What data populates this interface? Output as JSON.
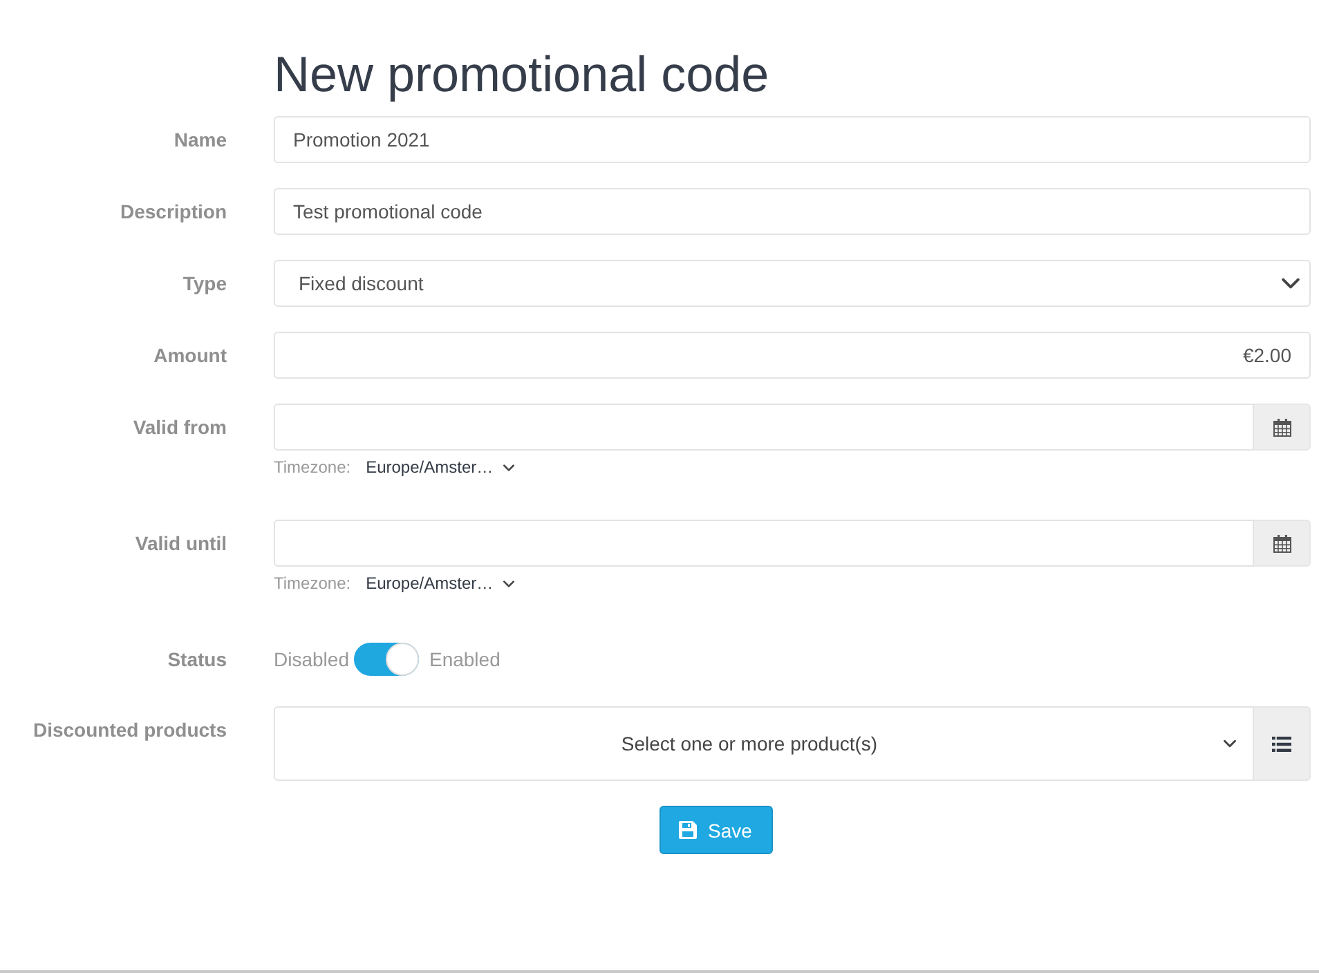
{
  "title": "New promotional code",
  "fields": [
    {
      "kind": "text",
      "label": "Name",
      "value": "Promotion 2021"
    },
    {
      "kind": "text",
      "label": "Description",
      "value": "Test promotional code"
    },
    {
      "kind": "select",
      "label": "Type",
      "value": "Fixed discount"
    },
    {
      "kind": "amount",
      "label": "Amount",
      "value": "€2.00"
    },
    {
      "kind": "date",
      "label": "Valid from",
      "timezone_label": "Timezone:",
      "timezone": "Europe/Amster…"
    },
    {
      "kind": "date",
      "label": "Valid until",
      "timezone_label": "Timezone:",
      "timezone": "Europe/Amster…"
    },
    {
      "kind": "toggle",
      "label": "Status",
      "off_label": "Disabled",
      "on_label": "Enabled",
      "on": true
    },
    {
      "kind": "multiselect",
      "label": "Discounted products",
      "placeholder": "Select one or more product(s)"
    }
  ],
  "save_button": {
    "label": "Save"
  }
}
